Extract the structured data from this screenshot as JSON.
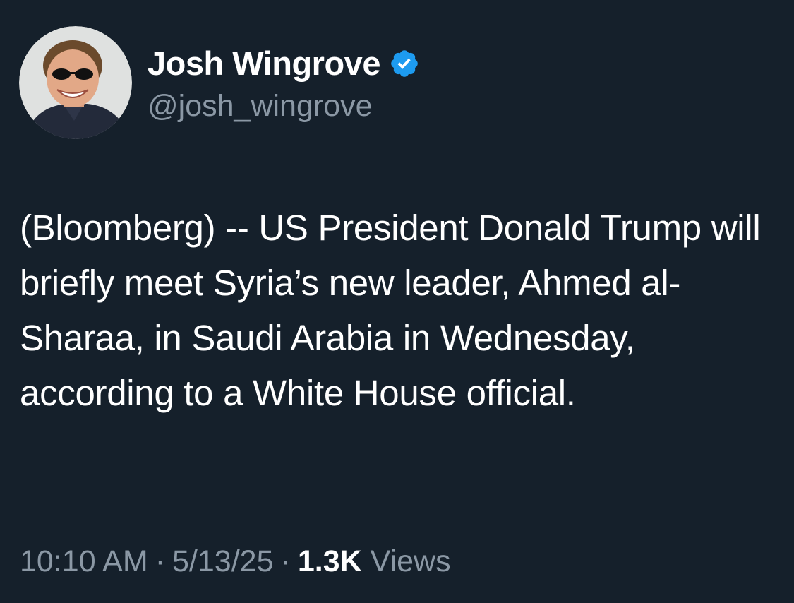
{
  "author": {
    "display_name": "Josh Wingrove",
    "handle": "@josh_wingrove",
    "verified": true,
    "avatar_icon": "profile-photo"
  },
  "tweet": {
    "text": "(Bloomberg) -- US President Donald Trump will briefly meet Syria’s new leader, Ahmed al-Sharaa, in Saudi Arabia in Wednesday, according to a White House official."
  },
  "meta": {
    "time": "10:10 AM",
    "separator": "·",
    "date": "5/13/25",
    "views_count": "1.3K",
    "views_label": "Views"
  },
  "colors": {
    "background": "#15202b",
    "text": "#ffffff",
    "secondary_text": "#8b98a5",
    "verified_badge": "#1d9bf0"
  }
}
